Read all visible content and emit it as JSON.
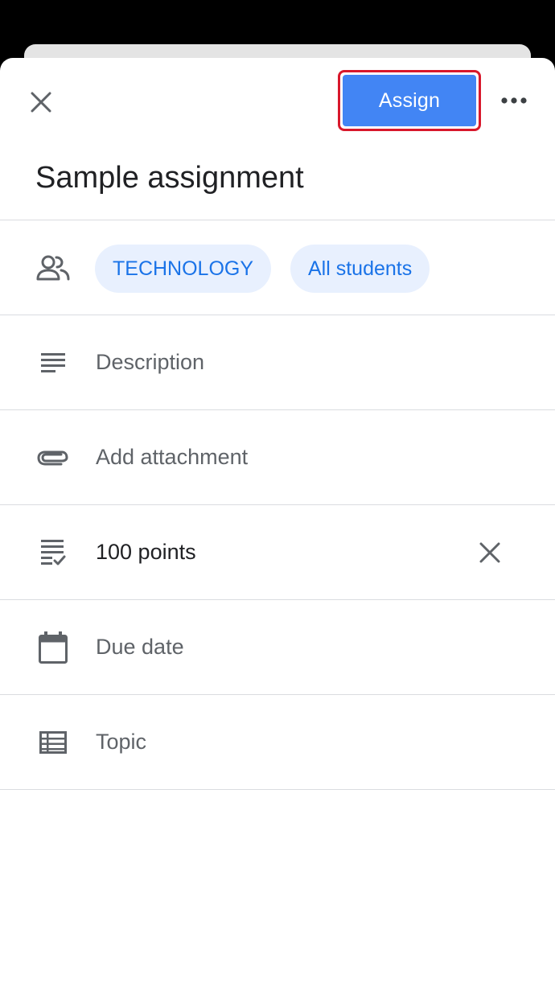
{
  "colors": {
    "accent": "#4285f4",
    "highlight_outline": "#d8182c",
    "chip_bg": "#e8f0fe",
    "chip_text": "#1a73e8",
    "icon": "#5f6368"
  },
  "toolbar": {
    "close_icon": "close-icon",
    "assign_label": "Assign",
    "more_icon": "more-horizontal-icon"
  },
  "assignment": {
    "title": "Sample assignment"
  },
  "recipients": {
    "icon": "people-icon",
    "class_chip": "TECHNOLOGY",
    "students_chip": "All students"
  },
  "fields": {
    "description": {
      "icon": "notes-icon",
      "placeholder": "Description"
    },
    "attachment": {
      "icon": "paperclip-icon",
      "placeholder": "Add attachment"
    },
    "points": {
      "icon": "grading-icon",
      "value": "100 points",
      "clear_icon": "close-icon"
    },
    "due_date": {
      "icon": "calendar-icon",
      "placeholder": "Due date"
    },
    "topic": {
      "icon": "topic-list-icon",
      "placeholder": "Topic"
    }
  }
}
